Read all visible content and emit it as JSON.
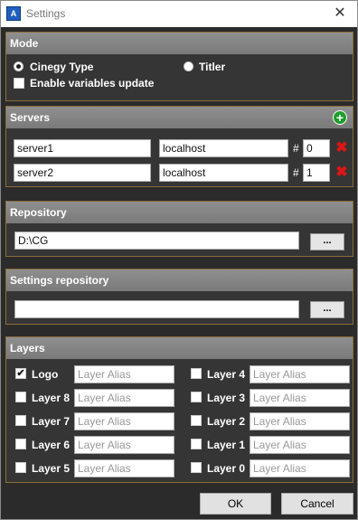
{
  "window": {
    "title": "Settings",
    "icon": "cinegy-app-icon"
  },
  "mode": {
    "header": "Mode",
    "options": [
      {
        "label": "Cinegy Type",
        "checked": true
      },
      {
        "label": "Titler",
        "checked": false
      }
    ],
    "enable_variables_label": "Enable variables update",
    "enable_variables_checked": false
  },
  "servers": {
    "header": "Servers",
    "rows": [
      {
        "name": "server1",
        "host": "localhost",
        "hash": "#",
        "index": "0"
      },
      {
        "name": "server2",
        "host": "localhost",
        "hash": "#",
        "index": "1"
      }
    ]
  },
  "repository": {
    "header": "Repository",
    "path": "D:\\CG",
    "browse_label": "..."
  },
  "settings_repository": {
    "header": "Settings repository",
    "path": "",
    "browse_label": "..."
  },
  "layers": {
    "header": "Layers",
    "alias_placeholder": "Layer Alias",
    "left": [
      {
        "label": "Logo",
        "checked": true
      },
      {
        "label": "Layer 8",
        "checked": false
      },
      {
        "label": "Layer 7",
        "checked": false
      },
      {
        "label": "Layer 6",
        "checked": false
      },
      {
        "label": "Layer 5",
        "checked": false
      }
    ],
    "right": [
      {
        "label": "Layer 4",
        "checked": false
      },
      {
        "label": "Layer 3",
        "checked": false
      },
      {
        "label": "Layer 2",
        "checked": false
      },
      {
        "label": "Layer 1",
        "checked": false
      },
      {
        "label": "Layer 0",
        "checked": false
      }
    ]
  },
  "buttons": {
    "ok": "OK",
    "cancel": "Cancel"
  }
}
